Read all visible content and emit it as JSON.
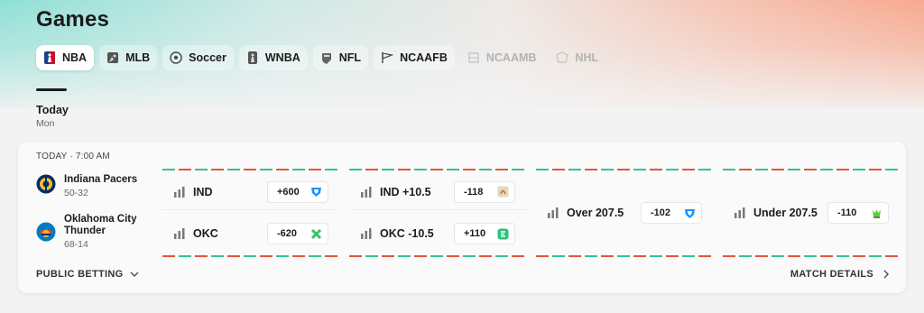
{
  "page": {
    "title": "Games"
  },
  "tabs": [
    {
      "label": "NBA",
      "icon": "nba-logo-icon",
      "state": "active"
    },
    {
      "label": "MLB",
      "icon": "mlb-logo-icon",
      "state": "normal"
    },
    {
      "label": "Soccer",
      "icon": "soccer-ball-icon",
      "state": "normal"
    },
    {
      "label": "WNBA",
      "icon": "wnba-logo-icon",
      "state": "normal"
    },
    {
      "label": "NFL",
      "icon": "nfl-logo-icon",
      "state": "normal"
    },
    {
      "label": "NCAAFB",
      "icon": "ncaafb-flag-icon",
      "state": "normal"
    },
    {
      "label": "NCAAMB",
      "icon": "ncaamb-logo-icon",
      "state": "disabled"
    },
    {
      "label": "NHL",
      "icon": "nhl-logo-icon",
      "state": "disabled"
    }
  ],
  "day": {
    "label": "Today",
    "sub": "Mon"
  },
  "game": {
    "time": "TODAY · 7:00 AM",
    "teams": [
      {
        "name": "Indiana Pacers",
        "record": "50-32",
        "logo": "indiana-pacers-logo"
      },
      {
        "name": "Oklahoma City Thunder",
        "record": "68-14",
        "logo": "okc-thunder-logo"
      }
    ],
    "markets": [
      {
        "type": "moneyline",
        "rows": [
          {
            "label": "IND",
            "odds": "+600",
            "book": "fanduel-icon"
          },
          {
            "label": "OKC",
            "odds": "-620",
            "book": "betmgm-x-icon"
          }
        ]
      },
      {
        "type": "spread",
        "rows": [
          {
            "label": "IND +10.5",
            "odds": "-118",
            "book": "caesars-icon"
          },
          {
            "label": "OKC -10.5",
            "odds": "+110",
            "book": "betrivers-icon"
          }
        ]
      },
      {
        "type": "total",
        "rows": [
          {
            "label": "Over 207.5",
            "odds": "-102",
            "book": "fanduel-icon"
          }
        ]
      },
      {
        "type": "total",
        "rows": [
          {
            "label": "Under 207.5",
            "odds": "-110",
            "book": "draftkings-icon"
          }
        ]
      }
    ],
    "footer": {
      "left": "PUBLIC BETTING",
      "right": "MATCH DETAILS"
    }
  },
  "colors": {
    "green": "#34c38f",
    "red": "#e2553d",
    "accent": "#1b1b1b"
  }
}
